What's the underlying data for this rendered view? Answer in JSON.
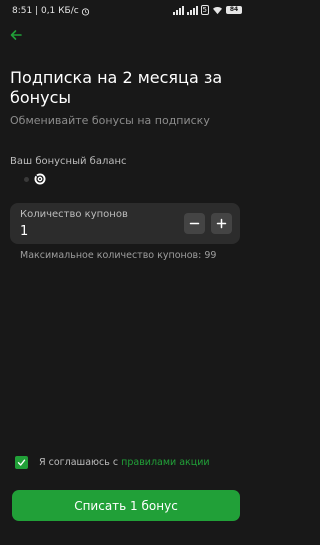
{
  "status_bar": {
    "time_speed": "8:51 | 0,1 КБ/с",
    "badge": "5",
    "battery": "84"
  },
  "header": {
    "back_icon": "arrow-left-icon",
    "title": "Подписка на 2 месяца за бонусы",
    "subtitle": "Обменивайте бонусы на подписку"
  },
  "balance": {
    "label": "Ваш бонусный баланс",
    "icon": "bonus-coin-icon"
  },
  "coupons": {
    "label": "Количество купонов",
    "value": "1",
    "minus_icon": "minus-icon",
    "plus_icon": "plus-icon",
    "max_text": "Максимальное количество купонов: 99"
  },
  "agreement": {
    "text": "Я соглашаюсь с",
    "link": "правилами акции",
    "checked": true
  },
  "submit": {
    "label": "Списать 1 бонус"
  },
  "colors": {
    "background": "#181818",
    "accent": "#21a038",
    "card": "#2c2c2c"
  }
}
